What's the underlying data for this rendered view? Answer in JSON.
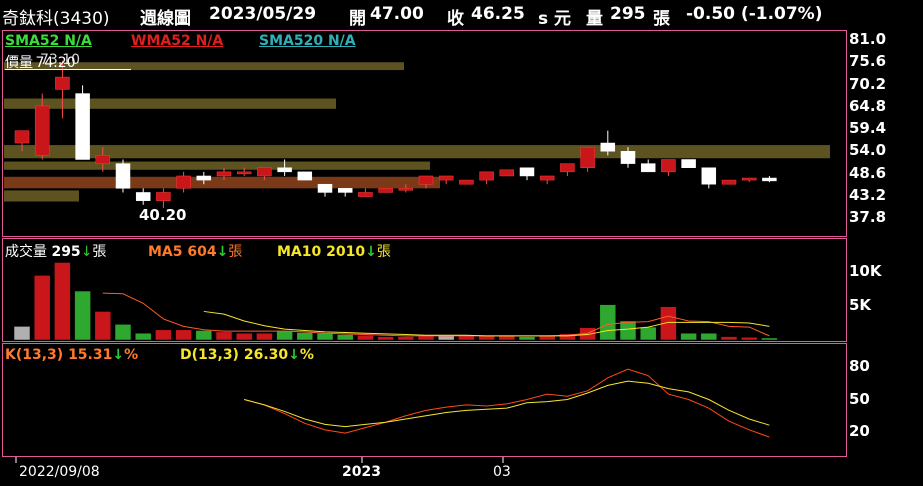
{
  "header": {
    "stock": "奇鈦科(3430)",
    "period": "週線圖",
    "date": "2023/05/29",
    "open_label": "開",
    "open": "47.00",
    "close_label": "收",
    "close": "46.25",
    "unit": "s 元",
    "vol_label": "量",
    "vol": "295",
    "vol_unit": "張",
    "change": "-0.50 (-1.07%)"
  },
  "main_panel": {
    "sma52": "SMA52 N/A",
    "wma52": "WMA52 N/A",
    "sma520": "SMA520 N/A",
    "price_overlay": "價量",
    "price_overlay_val1": "74.20",
    "price_overlay_val2": "73.10",
    "low_marker": "40.20",
    "y_ticks": [
      "81.0",
      "75.6",
      "70.2",
      "64.8",
      "59.4",
      "54.0",
      "48.6",
      "43.2",
      "37.8"
    ],
    "colors": {
      "up": "#c8161a",
      "down": "#ffffff",
      "profile": "#5c5320",
      "profile_hl": "#7a3a18"
    }
  },
  "volume_panel": {
    "label": "成交量",
    "value": "295",
    "unit": "張",
    "ma5_label": "MA5",
    "ma5": "604",
    "ma10_label": "MA10",
    "ma10": "2010",
    "y_ticks": [
      "10K",
      "5K"
    ]
  },
  "kd_panel": {
    "k_label": "K(13,3)",
    "k_value": "15.31",
    "d_label": "D(13,3)",
    "d_value": "26.30",
    "pct": "%",
    "y_ticks": [
      "80",
      "50",
      "20"
    ]
  },
  "x_axis": {
    "labels": [
      "2022/09/08",
      "2023",
      "03"
    ]
  },
  "chart_data": {
    "type": "candlestick",
    "ohlc": [
      {
        "o": 56,
        "h": 58,
        "l": 54,
        "c": 59
      },
      {
        "o": 53,
        "h": 68,
        "l": 52,
        "c": 65
      },
      {
        "o": 69,
        "h": 76,
        "l": 62,
        "c": 72
      },
      {
        "o": 68,
        "h": 70,
        "l": 52,
        "c": 52
      },
      {
        "o": 51,
        "h": 55,
        "l": 49,
        "c": 53
      },
      {
        "o": 51,
        "h": 52,
        "l": 44,
        "c": 45
      },
      {
        "o": 44,
        "h": 45,
        "l": 41,
        "c": 42
      },
      {
        "o": 42,
        "h": 45,
        "l": 40.2,
        "c": 44
      },
      {
        "o": 45,
        "h": 49,
        "l": 44,
        "c": 48
      },
      {
        "o": 48,
        "h": 49,
        "l": 46,
        "c": 47
      },
      {
        "o": 48,
        "h": 50,
        "l": 47,
        "c": 49
      },
      {
        "o": 49,
        "h": 50,
        "l": 48,
        "c": 49
      },
      {
        "o": 48,
        "h": 50,
        "l": 47,
        "c": 50
      },
      {
        "o": 50,
        "h": 52,
        "l": 48,
        "c": 49
      },
      {
        "o": 49,
        "h": 49,
        "l": 47,
        "c": 47
      },
      {
        "o": 46,
        "h": 46,
        "l": 43,
        "c": 44
      },
      {
        "o": 45,
        "h": 45,
        "l": 43,
        "c": 44
      },
      {
        "o": 43,
        "h": 45,
        "l": 43,
        "c": 44
      },
      {
        "o": 44,
        "h": 45,
        "l": 44,
        "c": 45
      },
      {
        "o": 45,
        "h": 46,
        "l": 44,
        "c": 45
      },
      {
        "o": 46,
        "h": 47,
        "l": 45,
        "c": 48
      },
      {
        "o": 47,
        "h": 48,
        "l": 46,
        "c": 48
      },
      {
        "o": 46,
        "h": 47,
        "l": 46,
        "c": 47
      },
      {
        "o": 47,
        "h": 49,
        "l": 46,
        "c": 49
      },
      {
        "o": 48,
        "h": 49,
        "l": 48,
        "c": 49.5
      },
      {
        "o": 50,
        "h": 50,
        "l": 47,
        "c": 48
      },
      {
        "o": 47,
        "h": 48,
        "l": 46,
        "c": 48
      },
      {
        "o": 49,
        "h": 51,
        "l": 48,
        "c": 51
      },
      {
        "o": 50,
        "h": 55,
        "l": 49,
        "c": 55
      },
      {
        "o": 56,
        "h": 59,
        "l": 53,
        "c": 54
      },
      {
        "o": 54,
        "h": 55,
        "l": 50,
        "c": 51
      },
      {
        "o": 51,
        "h": 52,
        "l": 49,
        "c": 49
      },
      {
        "o": 49,
        "h": 52,
        "l": 48,
        "c": 52
      },
      {
        "o": 52,
        "h": 52,
        "l": 50,
        "c": 50
      },
      {
        "o": 50,
        "h": 50,
        "l": 45,
        "c": 46
      },
      {
        "o": 46,
        "h": 47,
        "l": 46,
        "c": 47
      },
      {
        "o": 47,
        "h": 47.5,
        "l": 46.5,
        "c": 47.5
      },
      {
        "o": 47.5,
        "h": 48,
        "l": 46.5,
        "c": 46.8
      }
    ],
    "volume": [
      2000,
      9500,
      11400,
      7200,
      4200,
      2300,
      1000,
      1500,
      1500,
      1400,
      1200,
      1000,
      1000,
      1400,
      1100,
      1000,
      800,
      700,
      500,
      500,
      600,
      700,
      600,
      700,
      600,
      500,
      700,
      900,
      1800,
      5200,
      2800,
      1900,
      4900,
      1000,
      1000,
      500,
      400,
      295
    ],
    "volume_ma5": [
      null,
      null,
      null,
      null,
      6900,
      6800,
      5400,
      3100,
      2000,
      1500,
      1300,
      1300,
      1300,
      1300,
      1200,
      1000,
      900,
      800,
      700,
      600,
      600,
      600,
      600,
      600,
      600,
      600,
      600,
      700,
      1000,
      2300,
      2600,
      2700,
      3500,
      2800,
      2700,
      2000,
      1900,
      604
    ],
    "volume_ma10": [
      null,
      null,
      null,
      null,
      null,
      null,
      null,
      null,
      null,
      4200,
      3800,
      2800,
      2100,
      1600,
      1400,
      1200,
      1100,
      1000,
      900,
      800,
      700,
      700,
      700,
      600,
      600,
      600,
      600,
      600,
      800,
      1400,
      1600,
      1900,
      2600,
      2600,
      2600,
      2600,
      2500,
      2010
    ],
    "k": [
      null,
      null,
      null,
      null,
      null,
      null,
      null,
      null,
      null,
      null,
      null,
      50,
      45,
      37,
      28,
      22,
      19,
      24,
      29,
      35,
      40,
      43,
      45,
      44,
      46,
      50,
      55,
      53,
      58,
      70,
      78,
      72,
      55,
      50,
      42,
      30,
      22,
      15.31
    ],
    "d": [
      null,
      null,
      null,
      null,
      null,
      null,
      null,
      null,
      null,
      null,
      null,
      50,
      45,
      39,
      32,
      27,
      25,
      27,
      29,
      32,
      35,
      38,
      40,
      41,
      42,
      47,
      48,
      50,
      56,
      63,
      67,
      65,
      60,
      57,
      50,
      40,
      32,
      26.3
    ],
    "profile": [
      {
        "lo": 75.6,
        "hi": 73.7,
        "w": 400
      },
      {
        "lo": 66.8,
        "hi": 64.3,
        "w": 332
      },
      {
        "lo": 55.5,
        "hi": 52.3,
        "w": 826
      },
      {
        "lo": 51.5,
        "hi": 49.5,
        "w": 426
      },
      {
        "lo": 47.8,
        "hi": 45.0,
        "w": 436
      },
      {
        "lo": 44.5,
        "hi": 41.8,
        "w": 75
      }
    ],
    "ylim": [
      35,
      83
    ],
    "vol_ylim": [
      0,
      12000
    ],
    "kd_ylim": [
      0,
      100
    ]
  }
}
